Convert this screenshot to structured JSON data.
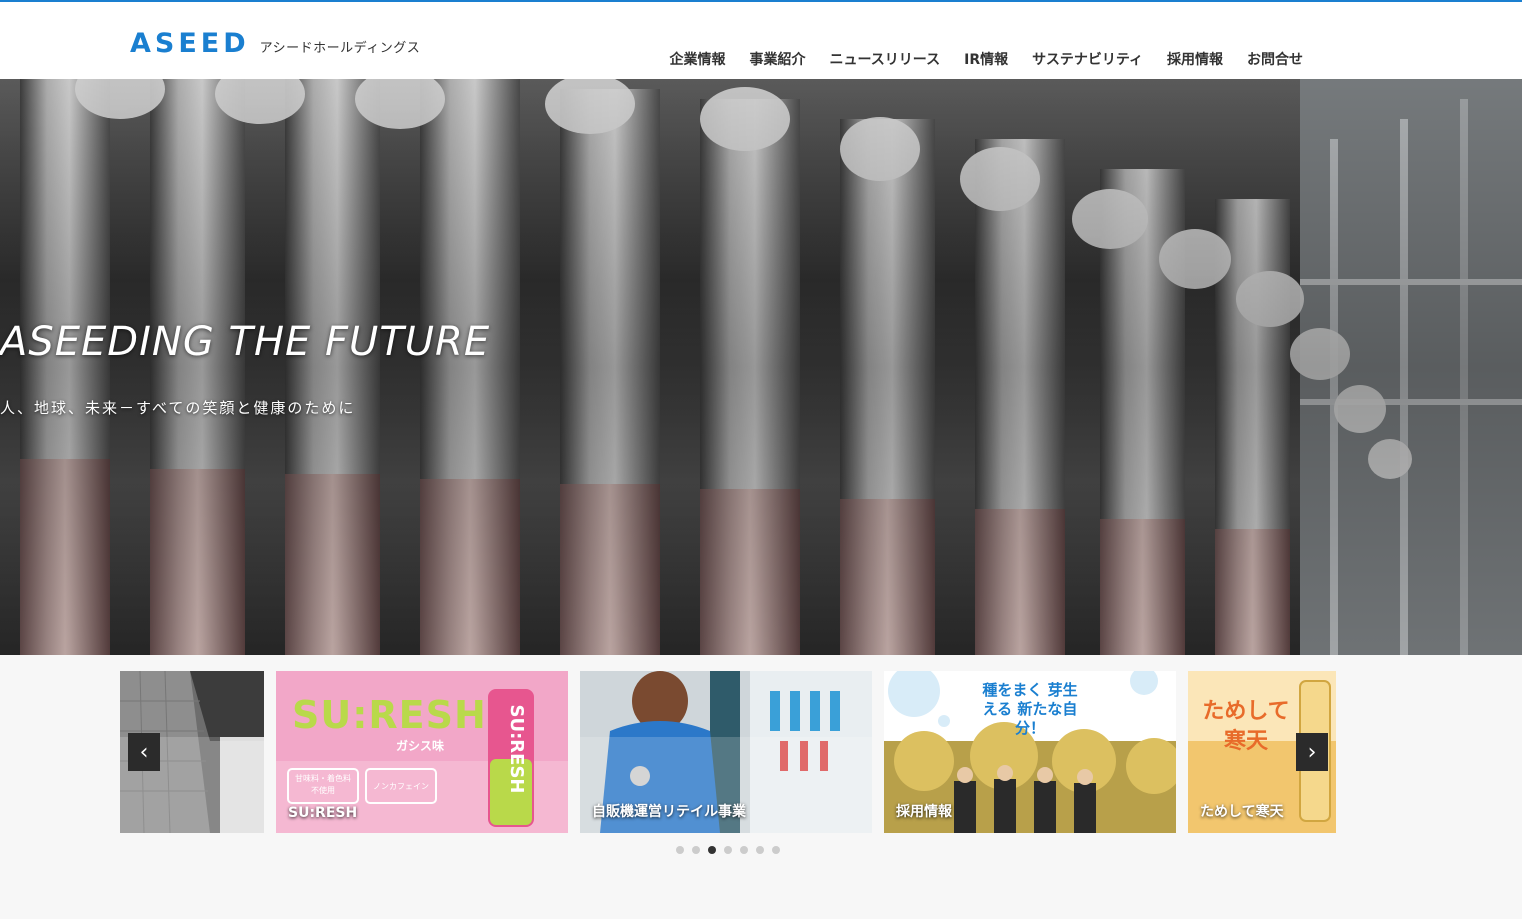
{
  "header": {
    "logo_mark": "ASEED",
    "logo_sub": "アシードホールディングス",
    "nav": [
      "企業情報",
      "事業紹介",
      "ニュースリリース",
      "IR情報",
      "サステナビリティ",
      "採用情報",
      "お問合せ"
    ]
  },
  "hero": {
    "title": "ASEEDING THE FUTURE",
    "subtitle": "人、地球、未来－すべての笑顔と健康のために"
  },
  "carousel": {
    "prev_label": "‹",
    "next_label": "›",
    "cards": [
      {
        "caption": ""
      },
      {
        "caption": "SU:RESH",
        "logo": "SU:RESH",
        "tagline": "ガシス味",
        "badge1": "甘味料・着色料 不使用",
        "badge2": "ノンカフェイン"
      },
      {
        "caption": "自販機運営リテイル事業"
      },
      {
        "caption": "採用情報",
        "headline": "種をまく 芽生える 新たな自分！"
      },
      {
        "caption": "ためして寒天",
        "headline": "ためして 寒天"
      }
    ],
    "dots": 7,
    "active_dot": 3
  },
  "colors": {
    "brand": "#1a7fd0",
    "suresh_pink": "#f2a7c8",
    "suresh_green": "#b9d94a"
  }
}
